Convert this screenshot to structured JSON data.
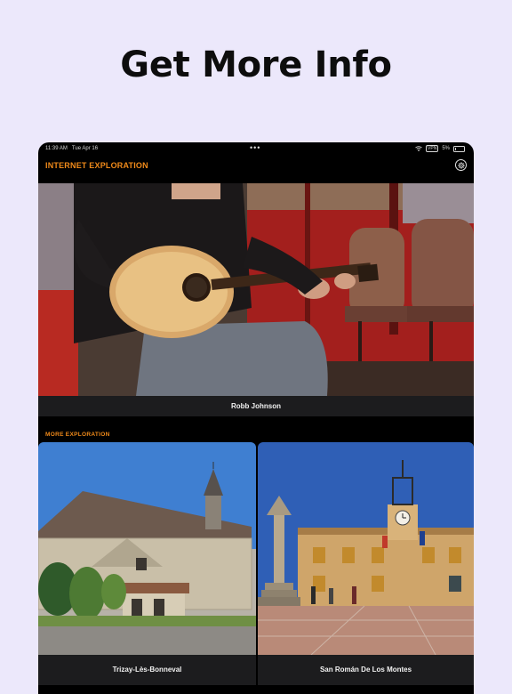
{
  "headline": "Get More Info",
  "status_bar": {
    "time": "11:39 AM",
    "date": "Tue Apr 16",
    "vpn": "VPN",
    "battery": "5%"
  },
  "nav": {
    "title": "INTERNET EXPLORATION",
    "settings_icon": "gear-icon"
  },
  "featured": {
    "caption": "Robb Johnson"
  },
  "more_section": {
    "label": "MORE EXPLORATION",
    "items": [
      {
        "caption": "Trizay-Lès-Bonneval"
      },
      {
        "caption": "San Román De Los Montes"
      }
    ]
  },
  "colors": {
    "background": "#ece8fb",
    "accent": "#f08a1a",
    "device": "#000000",
    "caption_bar": "#1c1c1e"
  }
}
